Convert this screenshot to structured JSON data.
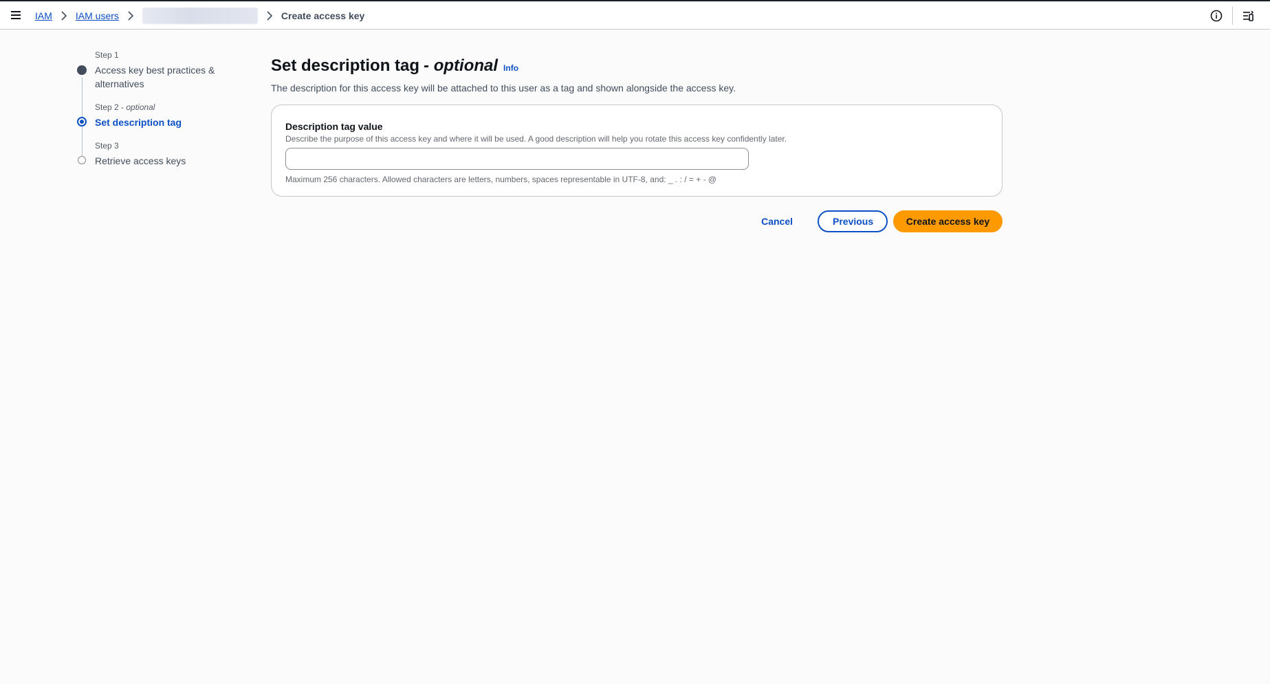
{
  "breadcrumb": {
    "items": [
      "IAM",
      "IAM users"
    ],
    "current": "Create access key"
  },
  "steps": [
    {
      "number": "Step 1",
      "title": "Access key best practices & alternatives",
      "state": "completed"
    },
    {
      "number": "Step 2",
      "optional_label": "optional",
      "title": "Set description tag",
      "state": "active"
    },
    {
      "number": "Step 3",
      "title": "Retrieve access keys",
      "state": "upcoming"
    }
  ],
  "page": {
    "title": "Set description tag",
    "title_suffix": "- optional",
    "info_link": "Info",
    "description": "The description for this access key will be attached to this user as a tag and shown alongside the access key."
  },
  "form": {
    "label": "Description tag value",
    "description": "Describe the purpose of this access key and where it will be used. A good description will help you rotate this access key confidently later.",
    "value": "",
    "placeholder": "",
    "constraint": "Maximum 256 characters. Allowed characters are letters, numbers, spaces representable in UTF-8, and: _ . : / = + - @"
  },
  "actions": {
    "cancel": "Cancel",
    "previous": "Previous",
    "create": "Create access key"
  },
  "colors": {
    "link": "#0b50c6",
    "primary_button": "#ff9900",
    "text": "#0f141a"
  },
  "icons": {
    "menu": "hamburger-icon",
    "separator": "chevron-right-icon",
    "info": "info-circle-icon",
    "settings": "split-panel-icon"
  }
}
